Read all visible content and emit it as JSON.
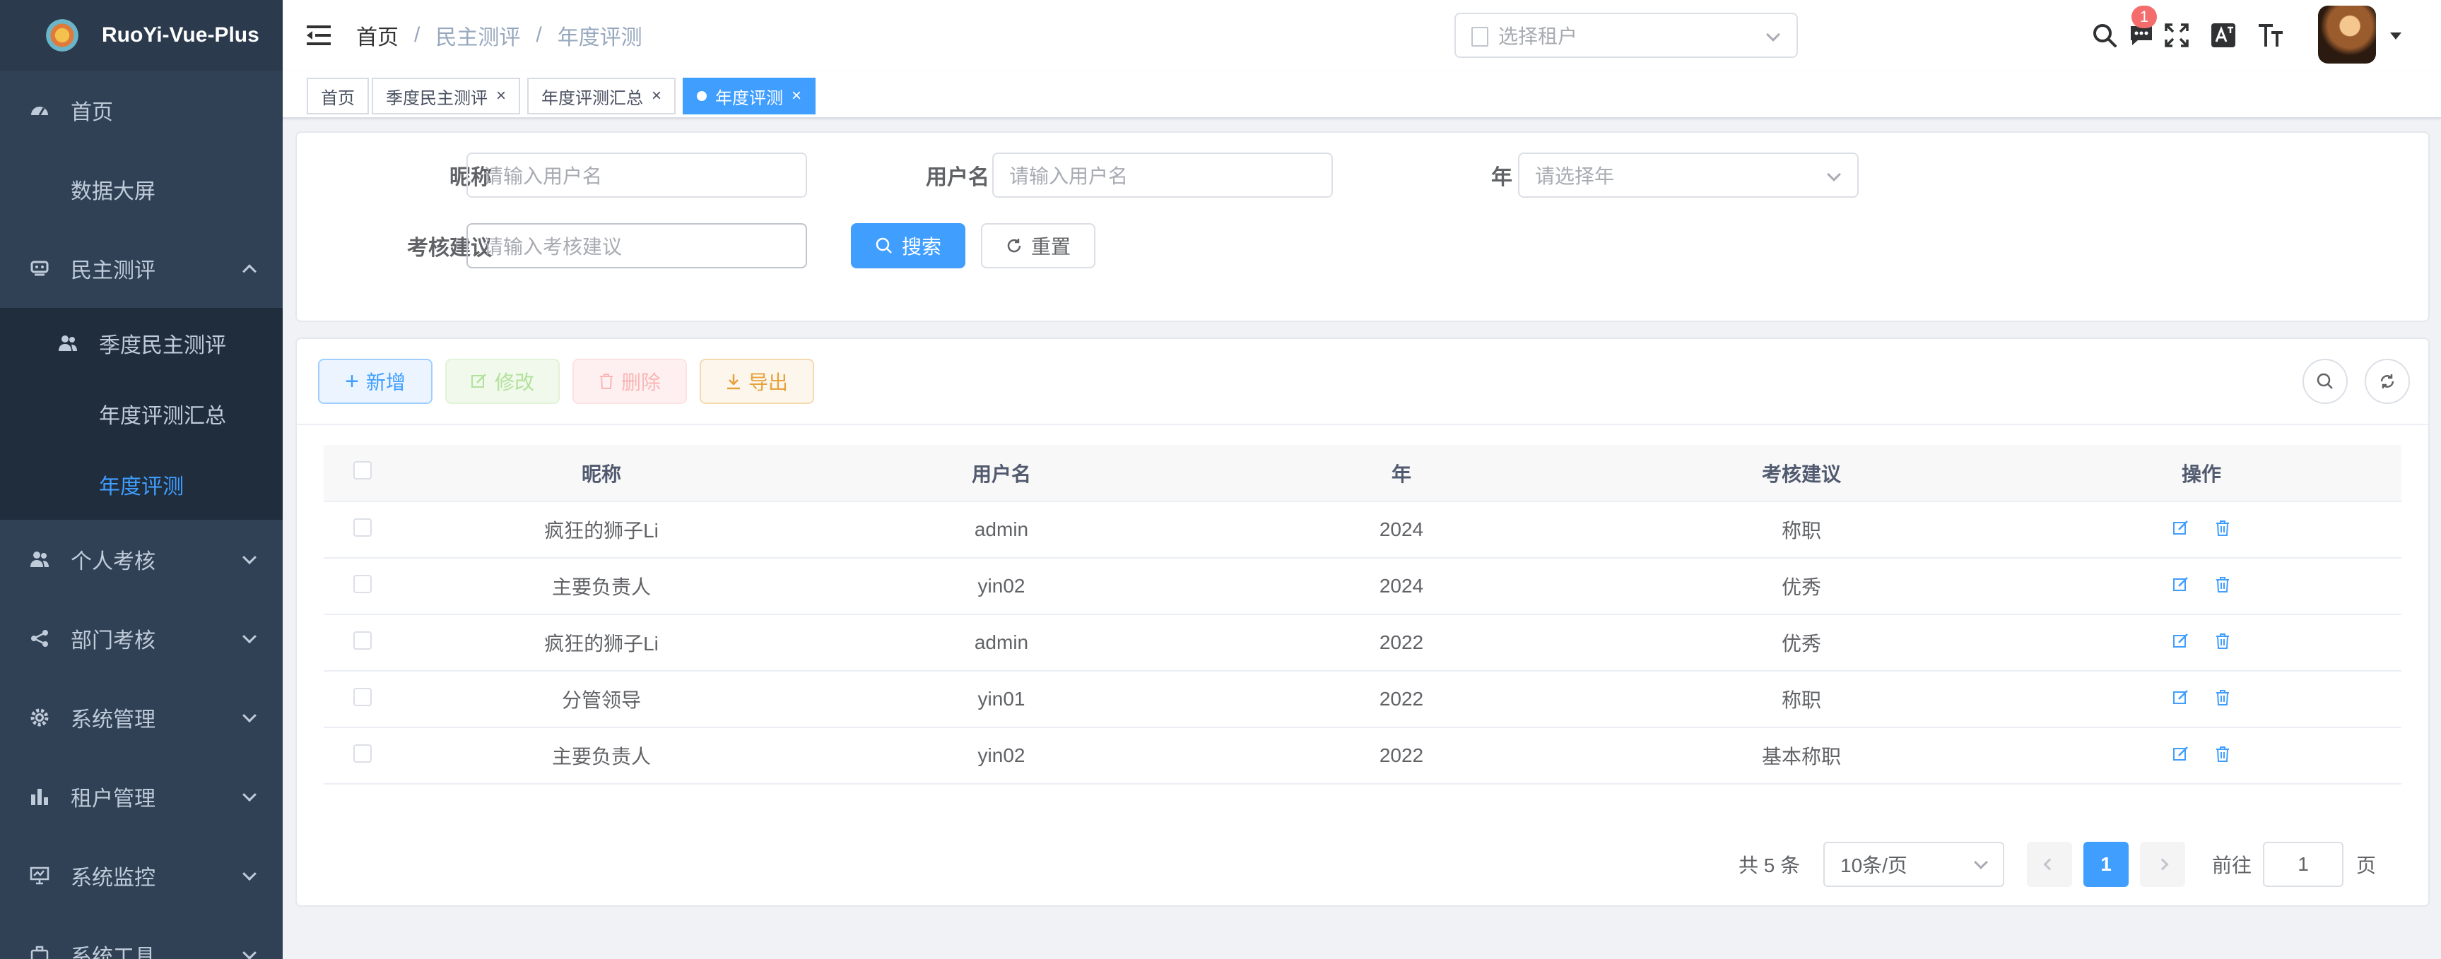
{
  "app": {
    "title": "RuoYi-Vue-Plus"
  },
  "sidebar": {
    "items": [
      {
        "label": "首页",
        "icon": "dashboard-icon"
      },
      {
        "label": "数据大屏"
      },
      {
        "label": "民主测评",
        "icon": "survey-icon",
        "expanded": true
      },
      {
        "label": "个人考核",
        "icon": "people-icon"
      },
      {
        "label": "部门考核",
        "icon": "tree-icon"
      },
      {
        "label": "系统管理",
        "icon": "gear-icon"
      },
      {
        "label": "租户管理",
        "icon": "chart-icon"
      },
      {
        "label": "系统监控",
        "icon": "monitor-icon"
      },
      {
        "label": "系统工具",
        "icon": "tool-icon"
      }
    ],
    "submenu": [
      {
        "label": "季度民主测评",
        "icon": "peoples-icon"
      },
      {
        "label": "年度评测汇总"
      },
      {
        "label": "年度评测",
        "active": true
      }
    ]
  },
  "navbar": {
    "breadcrumb": [
      "首页",
      "民主测评",
      "年度评测"
    ],
    "breadcrumb_sep": "/",
    "tenant_placeholder": "选择租户",
    "notice_count": "1"
  },
  "tags": [
    {
      "label": "首页"
    },
    {
      "label": "季度民主测评",
      "close": "×"
    },
    {
      "label": "年度评测汇总",
      "close": "×"
    },
    {
      "label": "年度评测",
      "close": "×",
      "active": true
    }
  ],
  "search": {
    "nickname_label": "昵称",
    "nickname_placeholder": "请输入用户名",
    "username_label": "用户名",
    "username_placeholder": "请输入用户名",
    "year_label": "年",
    "year_placeholder": "请选择年",
    "advice_label": "考核建议",
    "advice_placeholder": "请输入考核建议",
    "search_btn": "搜索",
    "reset_btn": "重置"
  },
  "toolbar": {
    "add": "新增",
    "edit": "修改",
    "delete": "删除",
    "export": "导出"
  },
  "table": {
    "columns": [
      "昵称",
      "用户名",
      "年",
      "考核建议",
      "操作"
    ],
    "rows": [
      [
        "疯狂的狮子Li",
        "admin",
        "2024",
        "称职"
      ],
      [
        "主要负责人",
        "yin02",
        "2024",
        "优秀"
      ],
      [
        "疯狂的狮子Li",
        "admin",
        "2022",
        "优秀"
      ],
      [
        "分管领导",
        "yin01",
        "2022",
        "称职"
      ],
      [
        "主要负责人",
        "yin02",
        "2022",
        "基本称职"
      ]
    ]
  },
  "pagination": {
    "total": "共 5 条",
    "page_size": "10条/页",
    "current": "1",
    "goto_label": "前往",
    "goto_value": "1",
    "page_unit": "页"
  },
  "colors": {
    "primary": "#409eff",
    "sidebar_bg": "#304156",
    "sidebar_text": "#bfcbd9"
  }
}
